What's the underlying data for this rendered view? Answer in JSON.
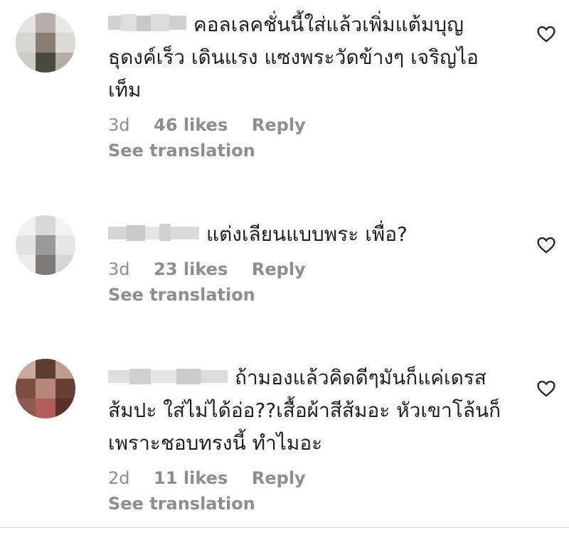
{
  "comments": [
    {
      "username": "",
      "text": "คอลเลคชั่นนี้ใส่แล้วเพิ่มแต้มบุญ ธุดงค์เร็ว เดินแรง แซงพระวัดข้างๆ เจริญไอเท็ม",
      "time": "3d",
      "likes": "46 likes",
      "reply": "Reply",
      "translate": "See translation",
      "heart_icon": "heart-outline-icon"
    },
    {
      "username": "",
      "text": "แต่งเลียนแบบพระ เพื่อ?",
      "time": "3d",
      "likes": "23 likes",
      "reply": "Reply",
      "translate": "See translation",
      "heart_icon": "heart-outline-icon"
    },
    {
      "username": "",
      "text": "ถ้ามองแล้วคิดดีๆมันก็แค่เดรสส้มปะ ใส่ไม่ได้อ่อ??เสื้อผ้าสีส้มอะ หัวเขาโล้นก็เพราะชอบทรงนี้ ทำไมอะ",
      "time": "2d",
      "likes": "11 likes",
      "reply": "Reply",
      "translate": "See translation",
      "heart_icon": "heart-outline-icon"
    }
  ],
  "colors": {
    "text": "#1f1f1f",
    "muted": "#8e8e8e",
    "divider": "#dbdbdb"
  }
}
